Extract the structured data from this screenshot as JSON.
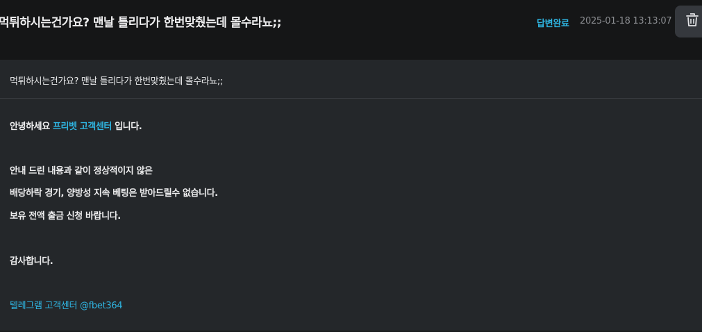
{
  "header": {
    "title": "먹튀하시는건가요? 맨날 틀리다가 한번맞췄는데 몰수라뇨;;",
    "status": "답변완료",
    "date": "2025-01-18 13:13:07",
    "delete_icon": "trash-icon"
  },
  "message": {
    "subject": "먹튀하시는건가요? 맨날 틀리다가 한번맞췄는데 몰수라뇨;;"
  },
  "reply": {
    "greeting_prefix": "안녕하세요 ",
    "greeting_brand": "프리벳 고객센터",
    "greeting_suffix": " 입니다.",
    "line1": "안내 드린 내용과 같이 정상적이지 않은",
    "line2": "배당하락 경기, 양방성 지속 베팅은 받아드릴수 없습니다.",
    "line3": "보유 전액 출금 신청 바랍니다.",
    "thanks": "감사합니다.",
    "telegram": "텔레그램 고객센터 @fbet364"
  },
  "colors": {
    "accent": "#2fb6e3",
    "background": "#151617",
    "panel": "#24272a",
    "muted": "#8a8c90"
  }
}
